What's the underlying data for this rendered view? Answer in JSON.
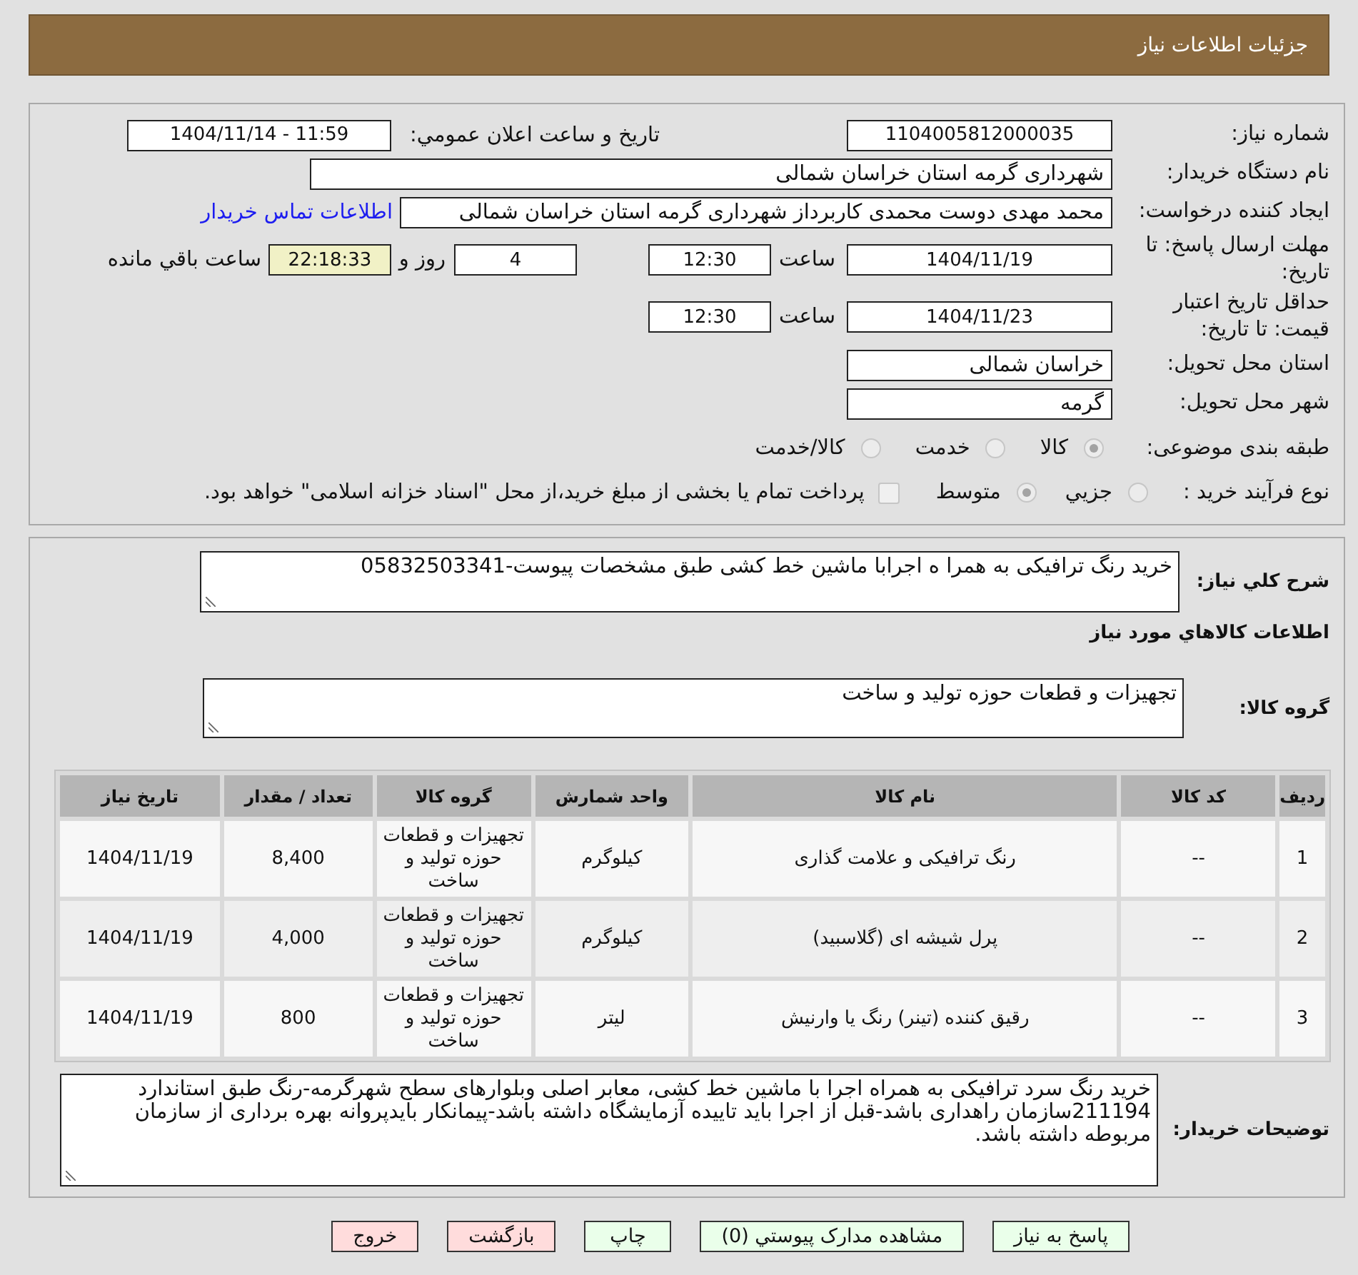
{
  "header": {
    "title": "جزئیات اطلاعات نیاز"
  },
  "details": {
    "need_number": {
      "label": "شماره نیاز:",
      "value": "1104005812000035"
    },
    "announce": {
      "label": "تاريخ و ساعت اعلان عمومي:",
      "value": "1404/11/14 - 11:59"
    },
    "buyer": {
      "label": "نام دستگاه خريدار:",
      "value": "شهرداری گرمه استان خراسان شمالی"
    },
    "creator": {
      "label": "ايجاد کننده درخواست:",
      "value": "محمد مهدی دوست محمدی کاربرداز شهرداری گرمه استان خراسان شمالی",
      "link": "اطلاعات تماس خريدار"
    },
    "deadline": {
      "label": "مهلت ارسال پاسخ: تا تاريخ:",
      "date": "1404/11/19",
      "time_label": "ساعت",
      "time": "12:30",
      "days": "4",
      "days_label": "روز و",
      "remaining": "22:18:33",
      "remaining_label": "ساعت باقي مانده"
    },
    "validity": {
      "label": "حداقل تاريخ اعتبار قيمت: تا تاريخ:",
      "date": "1404/11/23",
      "time_label": "ساعت",
      "time": "12:30"
    },
    "province": {
      "label": "استان محل تحويل:",
      "value": "خراسان شمالی"
    },
    "city": {
      "label": "شهر محل تحويل:",
      "value": "گرمه"
    },
    "category": {
      "label": "طبقه بندی موضوعی:",
      "options": [
        {
          "label": "کالا",
          "selected": true
        },
        {
          "label": "خدمت",
          "selected": false
        },
        {
          "label": "کالا/خدمت",
          "selected": false
        }
      ]
    },
    "process": {
      "label": "نوع فرآيند خريد :",
      "options": [
        {
          "label": "جزيي",
          "selected": false
        },
        {
          "label": "متوسط",
          "selected": true
        }
      ],
      "treasury": {
        "checked": false,
        "label": "پرداخت تمام یا بخشی از مبلغ خرید،از محل \"اسناد خزانه اسلامی\" خواهد بود."
      }
    }
  },
  "summary": {
    "label": "شرح کلي نياز:",
    "value": "خرید رنگ ترافیکی به همرا ه اجرابا ماشین خط کشی طبق مشخصات پیوست-05832503341"
  },
  "goods": {
    "heading": "اطلاعات کالاهاي مورد نياز",
    "group_label": "گروه کالا:",
    "group_value": "تجهیزات و قطعات حوزه تولید و ساخت",
    "table": {
      "columns": [
        "ردیف",
        "کد کالا",
        "نام کالا",
        "واحد شمارش",
        "گروه کالا",
        "تعداد / مقدار",
        "تاریخ نیاز"
      ],
      "rows": [
        [
          "1",
          "--",
          "رنگ ترافیکی و علامت گذاری",
          "کیلوگرم",
          "تجهیزات و قطعات حوزه تولید و ساخت",
          "8,400",
          "1404/11/19"
        ],
        [
          "2",
          "--",
          "پرل شیشه ای (گلاسبید)",
          "کیلوگرم",
          "تجهیزات و قطعات حوزه تولید و ساخت",
          "4,000",
          "1404/11/19"
        ],
        [
          "3",
          "--",
          "رقیق کننده (تینر) رنگ یا وارنیش",
          "لیتر",
          "تجهیزات و قطعات حوزه تولید و ساخت",
          "800",
          "1404/11/19"
        ]
      ]
    }
  },
  "buyer_notes": {
    "label": "توضیحات خریدار:",
    "value": "خرید رنگ سرد ترافیکی به همراه اجرا با ماشین خط کشی، معابر اصلی وبلوارهای سطح شهرگرمه-رنگ طبق استاندارد 211194سازمان راهداری باشد-قبل از اجرا باید تاییده آزمایشگاه داشته باشد-پیمانکار بایدپروانه بهره برداری از سازمان مربوطه داشته باشد."
  },
  "buttons": [
    {
      "label": "پاسخ به نياز",
      "kind": "confirm"
    },
    {
      "label": "مشاهده مدارک پيوستي (0)",
      "kind": "confirm"
    },
    {
      "label": "چاپ",
      "kind": "confirm"
    },
    {
      "label": "بازگشت",
      "kind": "cancel"
    },
    {
      "label": "خروج",
      "kind": "cancel"
    }
  ]
}
